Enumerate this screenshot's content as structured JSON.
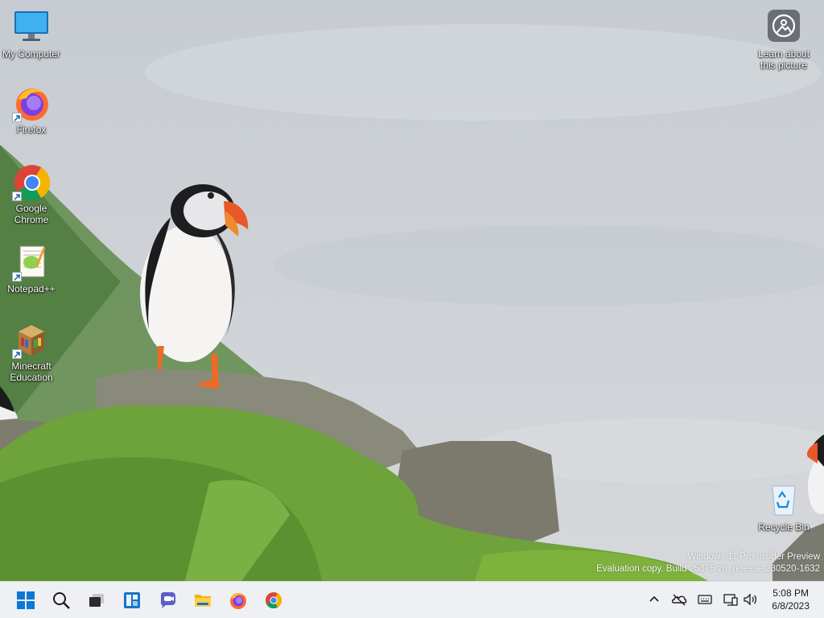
{
  "desktop": {
    "icons": [
      {
        "name": "my-computer",
        "label": "My Computer"
      },
      {
        "name": "firefox",
        "label": "Firefox"
      },
      {
        "name": "google-chrome",
        "label": "Google Chrome"
      },
      {
        "name": "notepad-plus-plus",
        "label": "Notepad++"
      },
      {
        "name": "minecraft-education",
        "label": "Minecraft Education"
      },
      {
        "name": "learn-about-picture",
        "label": "Learn about this picture"
      },
      {
        "name": "recycle-bin",
        "label": "Recycle Bin"
      }
    ],
    "watermark": {
      "line1": "Windows 11 Pro Insider Preview",
      "line2": "Evaluation copy. Build 25375.zn_release.230520-1632"
    }
  },
  "taskbar": {
    "buttons": [
      {
        "name": "start",
        "icon": "windows-logo-icon"
      },
      {
        "name": "search",
        "icon": "search-icon"
      },
      {
        "name": "task-view",
        "icon": "task-view-icon"
      },
      {
        "name": "widgets",
        "icon": "widgets-icon"
      },
      {
        "name": "teams-chat",
        "icon": "chat-icon"
      },
      {
        "name": "file-explorer",
        "icon": "folder-icon"
      },
      {
        "name": "firefox",
        "icon": "firefox-icon"
      },
      {
        "name": "chrome",
        "icon": "chrome-icon"
      }
    ],
    "tray": {
      "icons": [
        "chevron-up-icon",
        "onedrive-offline-icon",
        "keyboard-icon",
        "network-icon",
        "volume-icon"
      ]
    },
    "clock": {
      "time": "5:08 PM",
      "date": "6/8/2023"
    }
  },
  "colors": {
    "taskbar_bg": "#eef0f4",
    "accent": "#0067c0"
  }
}
